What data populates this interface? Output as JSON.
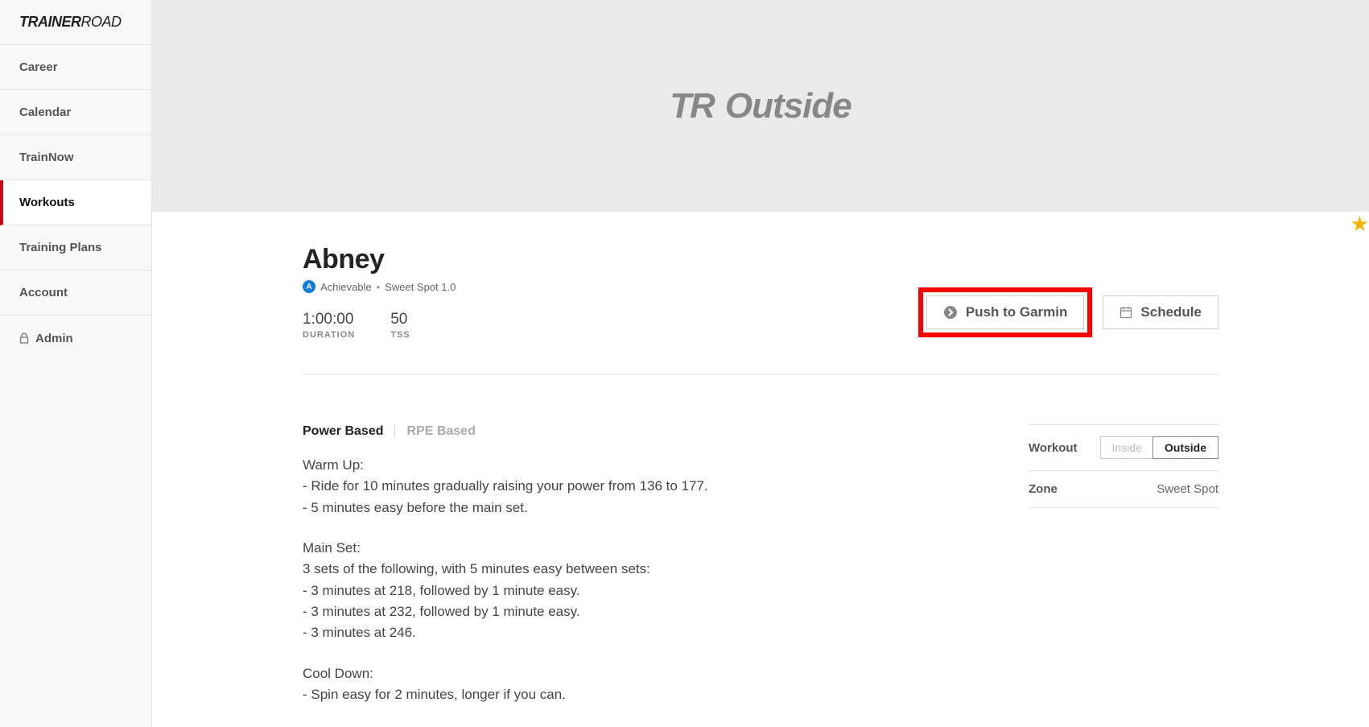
{
  "logo": {
    "bold": "TRAINER",
    "light": "ROAD"
  },
  "nav": {
    "items": [
      {
        "label": "Career",
        "active": false
      },
      {
        "label": "Calendar",
        "active": false
      },
      {
        "label": "TrainNow",
        "active": false
      },
      {
        "label": "Workouts",
        "active": true
      },
      {
        "label": "Training Plans",
        "active": false
      },
      {
        "label": "Account",
        "active": false
      }
    ],
    "admin_label": "Admin"
  },
  "hero": {
    "tr": "TR",
    "title": "Outside"
  },
  "workout": {
    "name": "Abney",
    "badge_letter": "A",
    "difficulty": "Achievable",
    "sep": "•",
    "category": "Sweet Spot 1.0",
    "duration_value": "1:00:00",
    "duration_label": "Duration",
    "tss_value": "50",
    "tss_label": "TSS"
  },
  "actions": {
    "push_label": "Push to Garmin",
    "schedule_label": "Schedule"
  },
  "tabs": {
    "power": "Power Based",
    "rpe": "RPE Based"
  },
  "description": {
    "l0": "Warm Up:",
    "l1": "- Ride for 10 minutes gradually raising your power from 136 to 177.",
    "l2": "- 5 minutes easy before the main set.",
    "l3": "Main Set:",
    "l4": "3 sets of the following, with 5 minutes easy between sets:",
    "l5": "- 3 minutes at 218, followed by 1 minute easy.",
    "l6": "- 3 minutes at 232, followed by 1 minute easy.",
    "l7": "- 3 minutes at 246.",
    "l8": "Cool Down:",
    "l9": "- Spin easy for 2 minutes, longer if you can."
  },
  "sidepanel": {
    "workout_label": "Workout",
    "inside": "Inside",
    "outside": "Outside",
    "zone_label": "Zone",
    "zone_value": "Sweet Spot"
  }
}
